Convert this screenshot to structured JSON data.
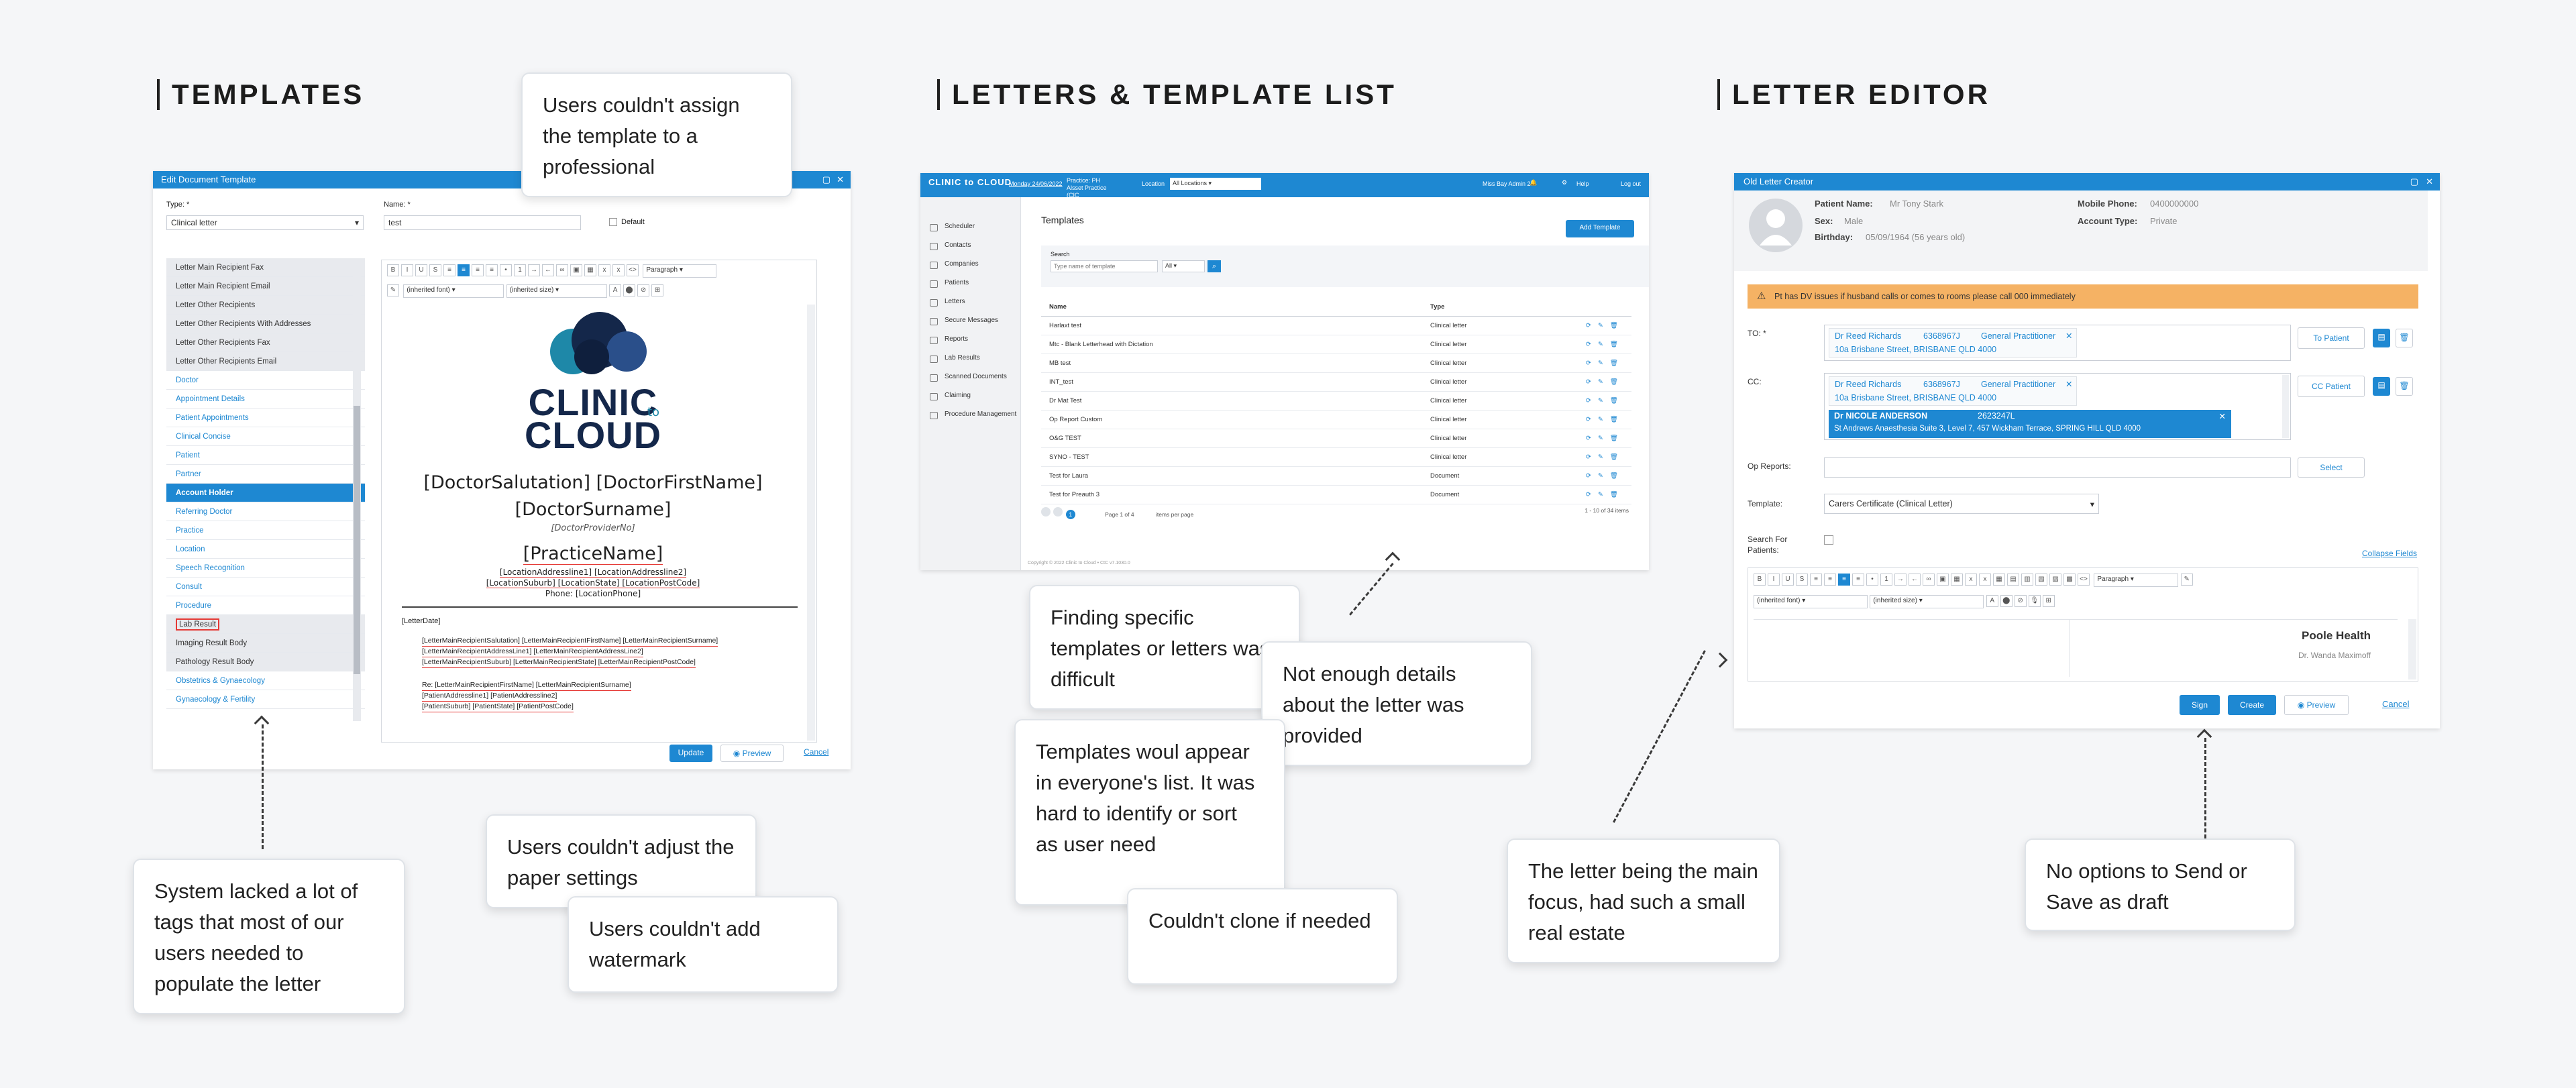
{
  "headings": {
    "templates": "TEMPLATES",
    "letters": "LETTERS & TEMPLATE LIST",
    "editor": "LETTER EDITOR"
  },
  "notes": {
    "assign": "Users couldn't assign the template to a professional",
    "tags": "System lacked a lot of tags that most of our users needed to populate the letter",
    "paper": "Users couldn't adjust the paper settings",
    "watermark": "Users couldn't add watermark",
    "finding": "Finding specific templates or letters was difficult",
    "details": "Not enough details about the letter was provided",
    "everyone": "Templates woul appear in everyone's list. It was hard to identify or sort as user need",
    "clone": "Couldn't clone if needed",
    "focus": "The letter being the main focus, had such a small real estate",
    "send": "No options to Send or Save as draft"
  },
  "template_shot": {
    "title": "Edit Document Template",
    "type_label": "Type: *",
    "type_value": "Clinical letter",
    "name_label": "Name: *",
    "name_value": "test",
    "default_label": "Default",
    "tag_items": [
      {
        "label": "Letter Main Recipient Fax",
        "kind": "grey"
      },
      {
        "label": "Letter Main Recipient Email",
        "kind": "grey"
      },
      {
        "label": "Letter Other Recipients",
        "kind": "grey"
      },
      {
        "label": "Letter Other Recipients With Addresses",
        "kind": "grey"
      },
      {
        "label": "Letter Other Recipients Fax",
        "kind": "grey"
      },
      {
        "label": "Letter Other Recipients Email",
        "kind": "grey"
      },
      {
        "label": "Doctor",
        "kind": "cat"
      },
      {
        "label": "Appointment Details",
        "kind": "cat"
      },
      {
        "label": "Patient Appointments",
        "kind": "cat"
      },
      {
        "label": "Clinical Concise",
        "kind": "cat"
      },
      {
        "label": "Patient",
        "kind": "cat"
      },
      {
        "label": "Partner",
        "kind": "cat"
      },
      {
        "label": "Account Holder",
        "kind": "active"
      },
      {
        "label": "Referring Doctor",
        "kind": "cat"
      },
      {
        "label": "Practice",
        "kind": "cat"
      },
      {
        "label": "Location",
        "kind": "cat"
      },
      {
        "label": "Speech Recognition",
        "kind": "cat"
      },
      {
        "label": "Consult",
        "kind": "cat"
      },
      {
        "label": "Procedure",
        "kind": "cat"
      },
      {
        "label": "Lab Result",
        "kind": "hl"
      },
      {
        "label": "Imaging Result Body",
        "kind": "grey"
      },
      {
        "label": "Pathology Result Body",
        "kind": "grey"
      },
      {
        "label": "Obstetrics & Gynaecology",
        "kind": "cat"
      },
      {
        "label": "Gynaecology & Fertility",
        "kind": "cat"
      }
    ],
    "paragraph_select": "Paragraph",
    "inherited_font": "(inherited font)",
    "inherited_size": "(inherited size)",
    "logo_line1": "CLINIC",
    "logo_to": "to",
    "logo_line2": "CLOUD",
    "doctor_line1": "[DoctorSalutation] [DoctorFirstName]",
    "doctor_line2": "[DoctorSurname]",
    "provider": "[DoctorProviderNo]",
    "practice": "[PracticeName]",
    "loc_line1": "[LocationAddressline1] [LocationAddressline2]",
    "loc_line2": "[LocationSuburb] [LocationState] [LocationPostCode]",
    "phone": "Phone: [LocationPhone]",
    "letter_date": "[LetterDate]",
    "recipient_line1": "[LetterMainRecipientSalutation] [LetterMainRecipientFirstName] [LetterMainRecipientSurname]",
    "recipient_line2": "[LetterMainRecipientAddressLine1] [LetterMainRecipientAddressLine2]",
    "recipient_line3": "[LetterMainRecipientSuburb] [LetterMainRecipientState] [LetterMainRecipientPostCode]",
    "re_line1": "Re: [LetterMainRecipientFirstName] [LetterMainRecipientSurname]",
    "re_line2": "[PatientAddressline1] [PatientAddressline2]",
    "re_line3": "[PatientSuburb] [PatientState] [PatientPostCode]",
    "update": "Update",
    "preview": "Preview",
    "cancel": "Cancel"
  },
  "letters_shot": {
    "brand": "CLINIC to CLOUD",
    "user_date": "Monday 24/06/2022",
    "practice": "Practice: PH Alsset Practice (CIC 44671837)",
    "location_label": "Location",
    "location_value": "All Locations",
    "header_user": "Miss Bay Admin 2",
    "help": "Help",
    "logout": "Log out",
    "side_items": [
      "Scheduler",
      "Contacts",
      "Companies",
      "Patients",
      "Letters",
      "Secure Messages",
      "Reports",
      "Lab Results",
      "Scanned Documents",
      "Claiming",
      "Procedure Management"
    ],
    "page_title": "Templates",
    "add_button": "Add Template",
    "search_label": "Search",
    "search_placeholder": "Type name of template",
    "search_filter": "All",
    "col_name": "Name",
    "col_type": "Type",
    "rows": [
      {
        "name": "Harlaxt test",
        "type": "Clinical letter"
      },
      {
        "name": "Mtc - Blank Letterhead with Dictation",
        "type": "Clinical letter"
      },
      {
        "name": "MB test",
        "type": "Clinical letter"
      },
      {
        "name": "INT_test",
        "type": "Clinical letter"
      },
      {
        "name": "Dr Mat Test",
        "type": "Clinical letter"
      },
      {
        "name": "Op Report Custom",
        "type": "Clinical letter"
      },
      {
        "name": "O&G TEST",
        "type": "Clinical letter"
      },
      {
        "name": "SYNO - TEST",
        "type": "Clinical letter"
      },
      {
        "name": "Test for Laura",
        "type": "Document"
      },
      {
        "name": "Test for Preauth 3",
        "type": "Document"
      }
    ],
    "pager": "Page 1 of 4",
    "per_page": "items per page",
    "count": "1 - 10 of 34 items",
    "footer": "Copyright © 2022 Clinic to Cloud • CtC v7.1030.0"
  },
  "editor_shot": {
    "title": "Old Letter Creator",
    "patient_name_label": "Patient Name:",
    "patient_name": "Mr Tony Stark",
    "sex_label": "Sex:",
    "sex": "Male",
    "birthday_label": "Birthday:",
    "birthday": "05/09/1964 (56 years old)",
    "mobile_label": "Mobile Phone:",
    "mobile": "0400000000",
    "account_label": "Account Type:",
    "account": "Private",
    "alert": "Pt has DV issues if husband calls or comes to rooms please call 000 immediately",
    "to_label": "TO: *",
    "to_name": "Dr Reed Richards",
    "to_number": "6368967J",
    "to_role": "General Practitioner",
    "to_address": "10a Brisbane Street, BRISBANE QLD 4000",
    "to_patient": "To Patient",
    "cc_label": "CC:",
    "cc_name": "Dr Reed Richards",
    "cc_number": "6368967J",
    "cc_role": "General Practitioner",
    "cc_address": "10a Brisbane Street, BRISBANE QLD 4000",
    "cc_suggest_name": "Dr NICOLE ANDERSON",
    "cc_suggest_number": "2623247L",
    "cc_suggest_address": "St Andrews Anaesthesia   Suite 3, Level 7, 457 Wickham Terrace, SPRING HILL QLD 4000",
    "cc_patient": "CC Patient",
    "op_label": "Op Reports:",
    "select": "Select",
    "template_label": "Template:",
    "template_value": "Carers Certificate (Clinical Letter)",
    "search_patients_label": "Search For Patients:",
    "collapse": "Collapse Fields",
    "paragraph_select": "Paragraph",
    "inherited_font": "(inherited font)",
    "inherited_size": "(inherited size)",
    "letter_head": "Poole Health",
    "letter_doctor": "Dr. Wanda Maximoff",
    "sign": "Sign",
    "create": "Create",
    "preview": "Preview",
    "cancel": "Cancel"
  },
  "colors": {
    "accent": "#1e88d2",
    "alert_bg": "#f5b264",
    "logo_navy": "#14274a",
    "logo_teal": "#1e88a8"
  }
}
